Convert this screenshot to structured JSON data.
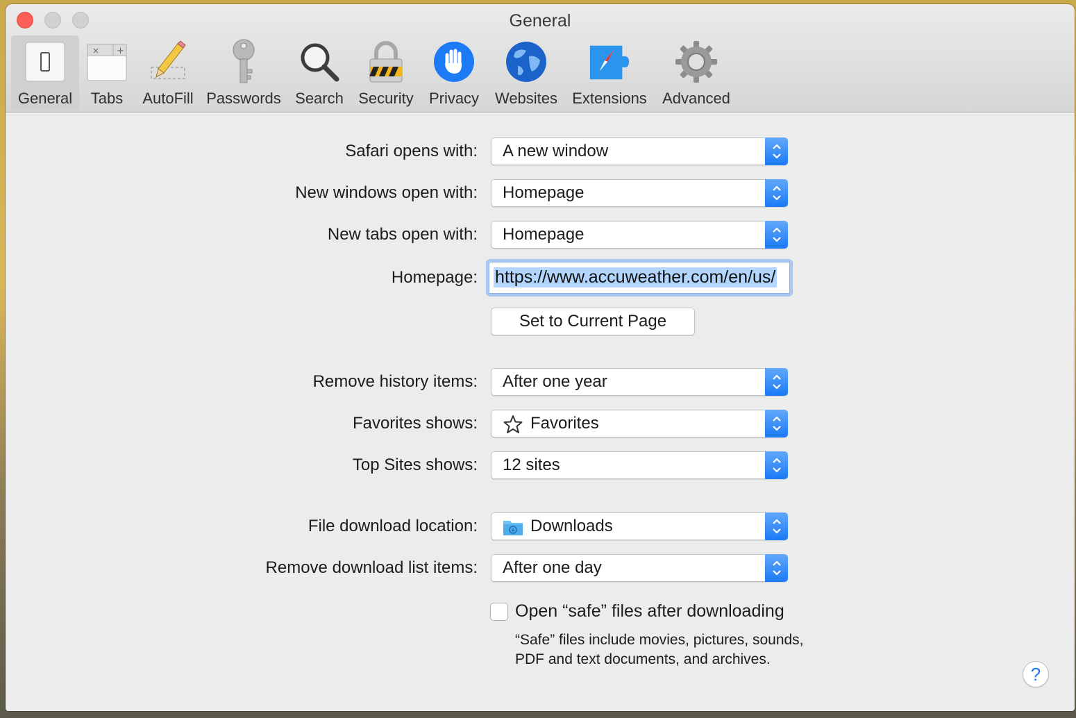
{
  "window": {
    "title": "General"
  },
  "toolbar": {
    "items": [
      {
        "label": "General",
        "icon": "general-switch-icon",
        "selected": true
      },
      {
        "label": "Tabs",
        "icon": "tabs-icon",
        "selected": false
      },
      {
        "label": "AutoFill",
        "icon": "pencil-icon",
        "selected": false
      },
      {
        "label": "Passwords",
        "icon": "key-icon",
        "selected": false
      },
      {
        "label": "Search",
        "icon": "magnifier-icon",
        "selected": false
      },
      {
        "label": "Security",
        "icon": "padlock-icon",
        "selected": false
      },
      {
        "label": "Privacy",
        "icon": "hand-icon",
        "selected": false
      },
      {
        "label": "Websites",
        "icon": "globe-icon",
        "selected": false
      },
      {
        "label": "Extensions",
        "icon": "puzzle-compass-icon",
        "selected": false
      },
      {
        "label": "Advanced",
        "icon": "gear-icon",
        "selected": false
      }
    ]
  },
  "settings": {
    "safari_opens_with": {
      "label": "Safari opens with:",
      "value": "A new window"
    },
    "new_windows_open_with": {
      "label": "New windows open with:",
      "value": "Homepage"
    },
    "new_tabs_open_with": {
      "label": "New tabs open with:",
      "value": "Homepage"
    },
    "homepage": {
      "label": "Homepage:",
      "value": "https://www.accuweather.com/en/us/"
    },
    "set_current_page": "Set to Current Page",
    "remove_history": {
      "label": "Remove history items:",
      "value": "After one year"
    },
    "favorites_shows": {
      "label": "Favorites shows:",
      "value": "Favorites",
      "icon": "star-icon"
    },
    "top_sites_shows": {
      "label": "Top Sites shows:",
      "value": "12 sites"
    },
    "download_location": {
      "label": "File download location:",
      "value": "Downloads",
      "icon": "downloads-folder-icon"
    },
    "remove_download_items": {
      "label": "Remove download list items:",
      "value": "After one day"
    },
    "open_safe_files": {
      "label": "Open “safe” files after downloading",
      "checked": false
    },
    "safe_files_note": "“Safe” files include movies, pictures, sounds, PDF and text documents, and archives."
  },
  "help": {
    "label": "?"
  },
  "colors": {
    "accent": "#1b7af5",
    "close": "#fc5f57",
    "window_bg": "#ececec"
  }
}
